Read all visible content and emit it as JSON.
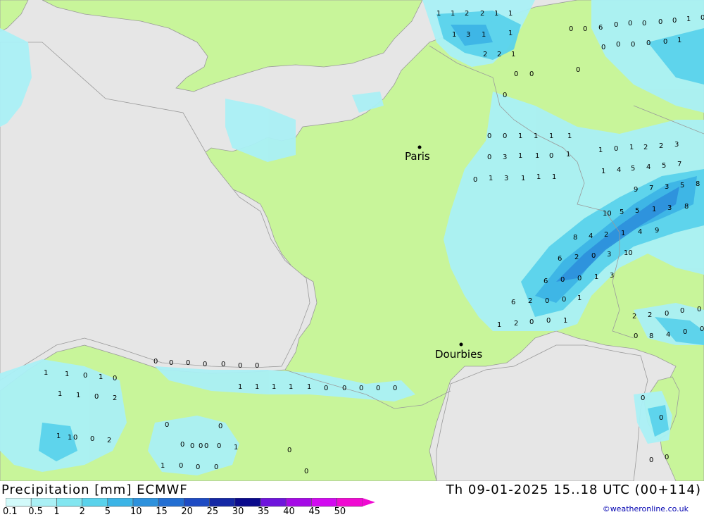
{
  "map": {
    "cities": [
      {
        "name": "Paris"
      },
      {
        "name": "Dourbies"
      }
    ],
    "colors": {
      "sea": "#e6e6e6",
      "land": "#c8f59a",
      "coast": "#9a9a9a"
    }
  },
  "footer": {
    "title": "Precipitation [mm] ECMWF",
    "valid": "Th 09-01-2025 15..18 UTC (00+114)",
    "credit": "©weatheronline.co.uk",
    "scale": [
      {
        "label": "0.1",
        "color": "#d2fafa"
      },
      {
        "label": "0.5",
        "color": "#aaf0f5"
      },
      {
        "label": "1",
        "color": "#82e6f0"
      },
      {
        "label": "2",
        "color": "#5ad2eb"
      },
      {
        "label": "5",
        "color": "#3cb4e6"
      },
      {
        "label": "10",
        "color": "#2d91dc"
      },
      {
        "label": "15",
        "color": "#236ed2"
      },
      {
        "label": "20",
        "color": "#1e4bc3"
      },
      {
        "label": "25",
        "color": "#1428a5"
      },
      {
        "label": "30",
        "color": "#0a0a8c"
      },
      {
        "label": "35",
        "color": "#6e14dc"
      },
      {
        "label": "40",
        "color": "#a50ae6"
      },
      {
        "label": "45",
        "color": "#d20af0"
      },
      {
        "label": "50",
        "color": "#f00ad2"
      }
    ]
  },
  "grid_values": [
    {
      "v": "1"
    },
    {
      "v": "1"
    },
    {
      "v": "2"
    },
    {
      "v": "2"
    },
    {
      "v": "1"
    },
    {
      "v": "1"
    },
    {
      "v": "1"
    },
    {
      "v": "3"
    },
    {
      "v": "1"
    },
    {
      "v": "1"
    },
    {
      "v": "2"
    },
    {
      "v": "2"
    },
    {
      "v": "1"
    },
    {
      "v": "0"
    },
    {
      "v": "0"
    },
    {
      "v": "6"
    },
    {
      "v": "0"
    },
    {
      "v": "0"
    },
    {
      "v": "0"
    },
    {
      "v": "0"
    },
    {
      "v": "0"
    },
    {
      "v": "1"
    },
    {
      "v": "0"
    },
    {
      "v": "0"
    },
    {
      "v": "0"
    },
    {
      "v": "0"
    },
    {
      "v": "0"
    },
    {
      "v": "0"
    },
    {
      "v": "1"
    },
    {
      "v": "0"
    },
    {
      "v": "0"
    },
    {
      "v": "0"
    },
    {
      "v": "0"
    },
    {
      "v": "0"
    },
    {
      "v": "0"
    },
    {
      "v": "1"
    },
    {
      "v": "1"
    },
    {
      "v": "1"
    },
    {
      "v": "1"
    },
    {
      "v": "0"
    },
    {
      "v": "3"
    },
    {
      "v": "1"
    },
    {
      "v": "1"
    },
    {
      "v": "0"
    },
    {
      "v": "1"
    },
    {
      "v": "1"
    },
    {
      "v": "0"
    },
    {
      "v": "1"
    },
    {
      "v": "2"
    },
    {
      "v": "2"
    },
    {
      "v": "3"
    },
    {
      "v": "0"
    },
    {
      "v": "1"
    },
    {
      "v": "3"
    },
    {
      "v": "1"
    },
    {
      "v": "1"
    },
    {
      "v": "1"
    },
    {
      "v": "1"
    },
    {
      "v": "4"
    },
    {
      "v": "5"
    },
    {
      "v": "4"
    },
    {
      "v": "5"
    },
    {
      "v": "7"
    },
    {
      "v": "9"
    },
    {
      "v": "7"
    },
    {
      "v": "3"
    },
    {
      "v": "5"
    },
    {
      "v": "8"
    },
    {
      "v": "10"
    },
    {
      "v": "5"
    },
    {
      "v": "5"
    },
    {
      "v": "1"
    },
    {
      "v": "3"
    },
    {
      "v": "8"
    },
    {
      "v": "8"
    },
    {
      "v": "4"
    },
    {
      "v": "2"
    },
    {
      "v": "1"
    },
    {
      "v": "4"
    },
    {
      "v": "9"
    },
    {
      "v": "6"
    },
    {
      "v": "2"
    },
    {
      "v": "0"
    },
    {
      "v": "3"
    },
    {
      "v": "10"
    },
    {
      "v": "6"
    },
    {
      "v": "0"
    },
    {
      "v": "0"
    },
    {
      "v": "1"
    },
    {
      "v": "3"
    },
    {
      "v": "6"
    },
    {
      "v": "2"
    },
    {
      "v": "0"
    },
    {
      "v": "0"
    },
    {
      "v": "1"
    },
    {
      "v": "1"
    },
    {
      "v": "2"
    },
    {
      "v": "0"
    },
    {
      "v": "0"
    },
    {
      "v": "1"
    },
    {
      "v": "2"
    },
    {
      "v": "2"
    },
    {
      "v": "0"
    },
    {
      "v": "0"
    },
    {
      "v": "0"
    },
    {
      "v": "0"
    },
    {
      "v": "8"
    },
    {
      "v": "4"
    },
    {
      "v": "0"
    },
    {
      "v": "0"
    },
    {
      "v": "0"
    },
    {
      "v": "0"
    },
    {
      "v": "0"
    },
    {
      "v": "0"
    },
    {
      "v": "0"
    },
    {
      "v": "0"
    },
    {
      "v": "0"
    },
    {
      "v": "1"
    },
    {
      "v": "1"
    },
    {
      "v": "1"
    },
    {
      "v": "1"
    },
    {
      "v": "1"
    },
    {
      "v": "0"
    },
    {
      "v": "0"
    },
    {
      "v": "0"
    },
    {
      "v": "0"
    },
    {
      "v": "0"
    },
    {
      "v": "1"
    },
    {
      "v": "1"
    },
    {
      "v": "0"
    },
    {
      "v": "1"
    },
    {
      "v": "0"
    },
    {
      "v": "1"
    },
    {
      "v": "1"
    },
    {
      "v": "0"
    },
    {
      "v": "2"
    },
    {
      "v": "1"
    },
    {
      "v": "1"
    },
    {
      "v": "0"
    },
    {
      "v": "0"
    },
    {
      "v": "2"
    },
    {
      "v": "0"
    },
    {
      "v": "0"
    },
    {
      "v": "0"
    },
    {
      "v": "0"
    },
    {
      "v": "0"
    },
    {
      "v": "0"
    },
    {
      "v": "0"
    },
    {
      "v": "1"
    },
    {
      "v": "0"
    },
    {
      "v": "1"
    },
    {
      "v": "0"
    },
    {
      "v": "0"
    },
    {
      "v": "0"
    },
    {
      "v": "0"
    },
    {
      "v": "0"
    },
    {
      "v": "0"
    },
    {
      "v": "0"
    },
    {
      "v": "0"
    },
    {
      "v": "0"
    },
    {
      "v": "0"
    },
    {
      "v": "1"
    },
    {
      "v": "0"
    },
    {
      "v": "0"
    },
    {
      "v": "0"
    }
  ]
}
